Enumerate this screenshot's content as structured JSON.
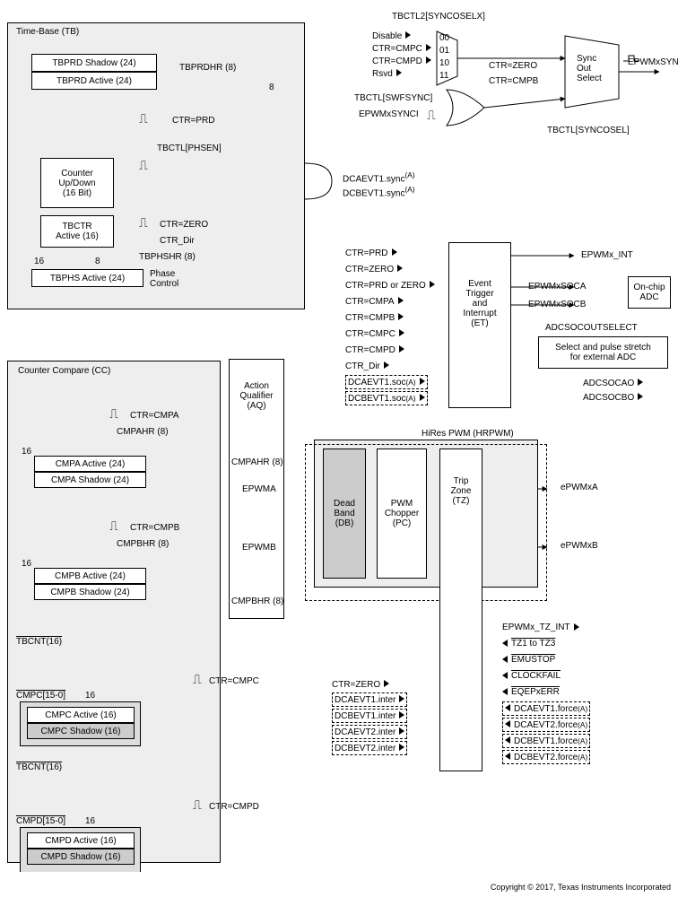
{
  "copyright": "Copyright © 2017, Texas Instruments Incorporated",
  "tb": {
    "title": "Time-Base (TB)",
    "tbprd_shadow": "TBPRD Shadow (24)",
    "tbprd_active": "TBPRD Active (24)",
    "tbprdhr": "TBPRDHR (8)",
    "ctr_prd": "CTR=PRD",
    "phsen": "TBCTL[PHSEN]",
    "counter": "Counter\nUp/Down\n(16 Bit)",
    "tbctr": "TBCTR\nActive (16)",
    "ctr_zero": "CTR=ZERO",
    "ctr_dir": "CTR_Dir",
    "tbphshr": "TBPHSHR (8)",
    "tbphs": "TBPHS Active (24)",
    "phase_ctrl": "Phase\nControl",
    "n16": "16",
    "n8a": "8",
    "n8b": "8"
  },
  "cc": {
    "title": "Counter Compare (CC)",
    "ctr_cmpa": "CTR=CMPA",
    "cmpahr8": "CMPAHR (8)",
    "cmpa_active": "CMPA Active (24)",
    "cmpa_shadow": "CMPA Shadow (24)",
    "ctr_cmpb": "CTR=CMPB",
    "cmpbhr8": "CMPBHR (8)",
    "cmpb_active": "CMPB Active (24)",
    "cmpb_shadow": "CMPB Shadow (24)",
    "tbcnt_c": "TBCNT(16)",
    "cmpc_header": "CMPC[15-0]",
    "cmpc_active": "CMPC Active (16)",
    "cmpc_shadow": "CMPC Shadow (16)",
    "ctr_cmpc": "CTR=CMPC",
    "tbcnt_d": "TBCNT(16)",
    "cmpd_header": "CMPD[15-0]",
    "cmpd_active": "CMPD Active (16)",
    "cmpd_shadow": "CMPD Shadow (16)",
    "ctr_cmpd": "CTR=CMPD",
    "n16": "16"
  },
  "aq": {
    "title": "Action\nQualifier\n(AQ)",
    "cmpahr": "CMPAHR (8)",
    "epwma": "EPWMA",
    "epwmb": "EPWMB",
    "cmpbhr": "CMPBHR (8)"
  },
  "hrpwm": {
    "title": "HiRes PWM (HRPWM)",
    "db": "Dead\nBand\n(DB)",
    "pc": "PWM\nChopper\n(PC)",
    "tz": "Trip\nZone\n(TZ)",
    "out_a": "ePWMxA",
    "out_b": "ePWMxB",
    "tz_int": "EPWMx_TZ_INT",
    "tz1to3": "TZ1 to TZ3",
    "emustop": "EMUSTOP",
    "clockfail": "CLOCKFAIL",
    "eqeperr": "EQEPxERR",
    "force1": "DCAEVT1.force",
    "force2": "DCAEVT2.force",
    "force3": "DCBEVT1.force",
    "force4": "DCBEVT2.force",
    "superA": "(A)",
    "ctr_zero": "CTR=ZERO",
    "inter1": "DCAEVT1.inter",
    "inter2": "DCBEVT1.inter",
    "inter3": "DCAEVT2.inter",
    "inter4": "DCBEVT2.inter"
  },
  "et": {
    "title": "Event\nTrigger\nand\nInterrupt\n(ET)",
    "in1": "CTR=PRD",
    "in2": "CTR=ZERO",
    "in3": "CTR=PRD or ZERO",
    "in4": "CTR=CMPA",
    "in5": "CTR=CMPB",
    "in6": "CTR=CMPC",
    "in7": "CTR=CMPD",
    "in8": "CTR_Dir",
    "in9": "DCAEVT1.soc",
    "in10": "DCBEVT1.soc",
    "out_int": "EPWMx_INT",
    "out_soca": "EPWMxSOCA",
    "out_socb": "EPWMxSOCB",
    "adc": "On-chip\nADC",
    "adcsel": "ADCSOCOUTSELECT",
    "stretch": "Select and pulse stretch\nfor external ADC",
    "adcsocao": "ADCSOCAO",
    "adcsocbo": "ADCSOCBO"
  },
  "sync": {
    "tbctl2": "TBCTL2[SYNCOSELX]",
    "opt0": "Disable",
    "opt1": "CTR=CMPC",
    "opt2": "CTR=CMPD",
    "opt3": "Rsvd",
    "c00": "00",
    "c01": "01",
    "c10": "10",
    "c11": "11",
    "swfsync": "TBCTL[SWFSYNC]",
    "epwmsynci": "EPWMxSYNCI",
    "ctr_zero": "CTR=ZERO",
    "ctr_cmpb": "CTR=CMPB",
    "soso": "Sync\nOut\nSelect",
    "synco": "EPWMxSYNCO",
    "syncosel": "TBCTL[SYNCOSEL]",
    "dca_sync": "DCAEVT1.sync",
    "dcb_sync": "DCBEVT1.sync"
  }
}
